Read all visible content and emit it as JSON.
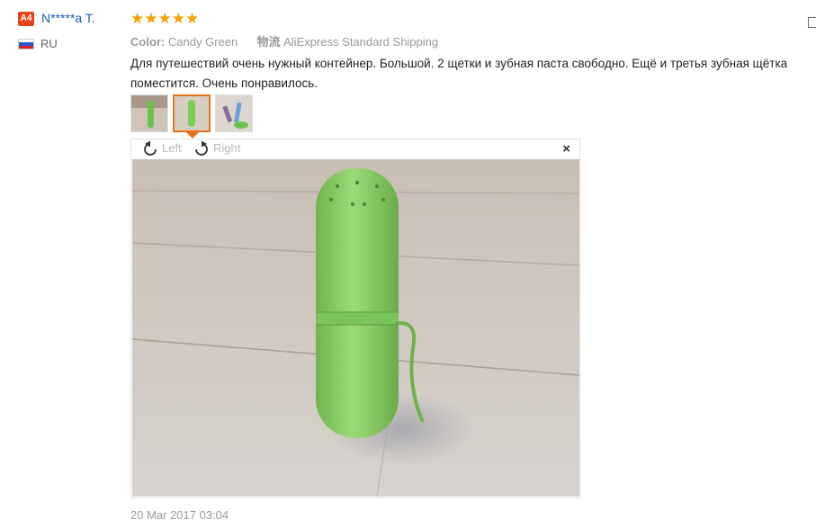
{
  "user": {
    "badge": "A4",
    "name": "N*****a T.",
    "country": "RU"
  },
  "review": {
    "stars": "★★★★★",
    "rating": 5,
    "color_label": "Color:",
    "color_value": "Candy Green",
    "shipping_label": "物流",
    "shipping_value": "AliExpress Standard Shipping",
    "text": "Для путешествий очень нужный контейнер. Большой. 2 щетки и зубная паста свободно. Ещё и третья зубная щётка поместится. Очень понравилось.",
    "date": "20 Mar 2017 03:04"
  },
  "viewer": {
    "left_label": "Left",
    "right_label": "Right",
    "close": "×"
  },
  "colors": {
    "star": "#f5a200",
    "accent": "#e8731a",
    "link": "#1a5fb4",
    "product": "#8fd16e"
  }
}
